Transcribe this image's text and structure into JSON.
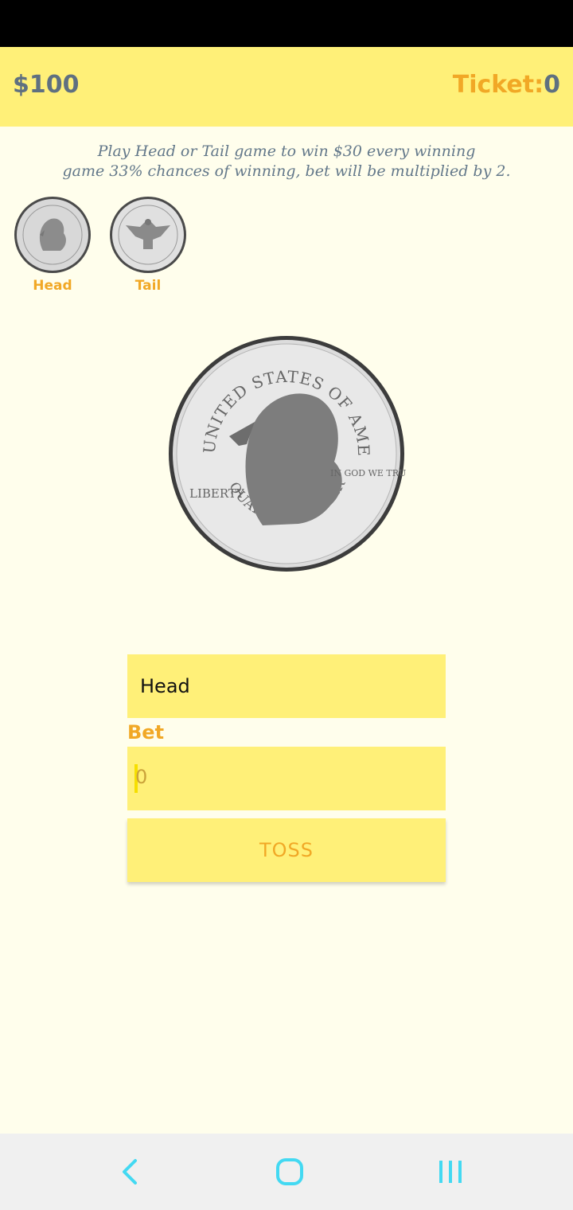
{
  "header": {
    "balance": "$100",
    "ticket_label": "Ticket:",
    "ticket_count": "0"
  },
  "intro": {
    "line1": "Play Head or Tail game to win $30 every winning",
    "line2": "game 33% chances of winning, bet will be multiplied by 2."
  },
  "coins": {
    "head_label": "Head",
    "tail_label": "Tail"
  },
  "form": {
    "choice_value": "Head",
    "bet_label": "Bet",
    "bet_value": "0",
    "toss_label": "TOSS"
  },
  "coin_text": {
    "top": "UNITED STATES OF AMERICA",
    "bottom": "QUARTER DOLLAR",
    "liberty": "LIBERTY",
    "motto": "IN GOD WE TRUST"
  },
  "colors": {
    "header_bg": "#fff078",
    "accent": "#f1a826",
    "page_bg": "#fffeec",
    "nav_icon": "#43d9f2"
  }
}
